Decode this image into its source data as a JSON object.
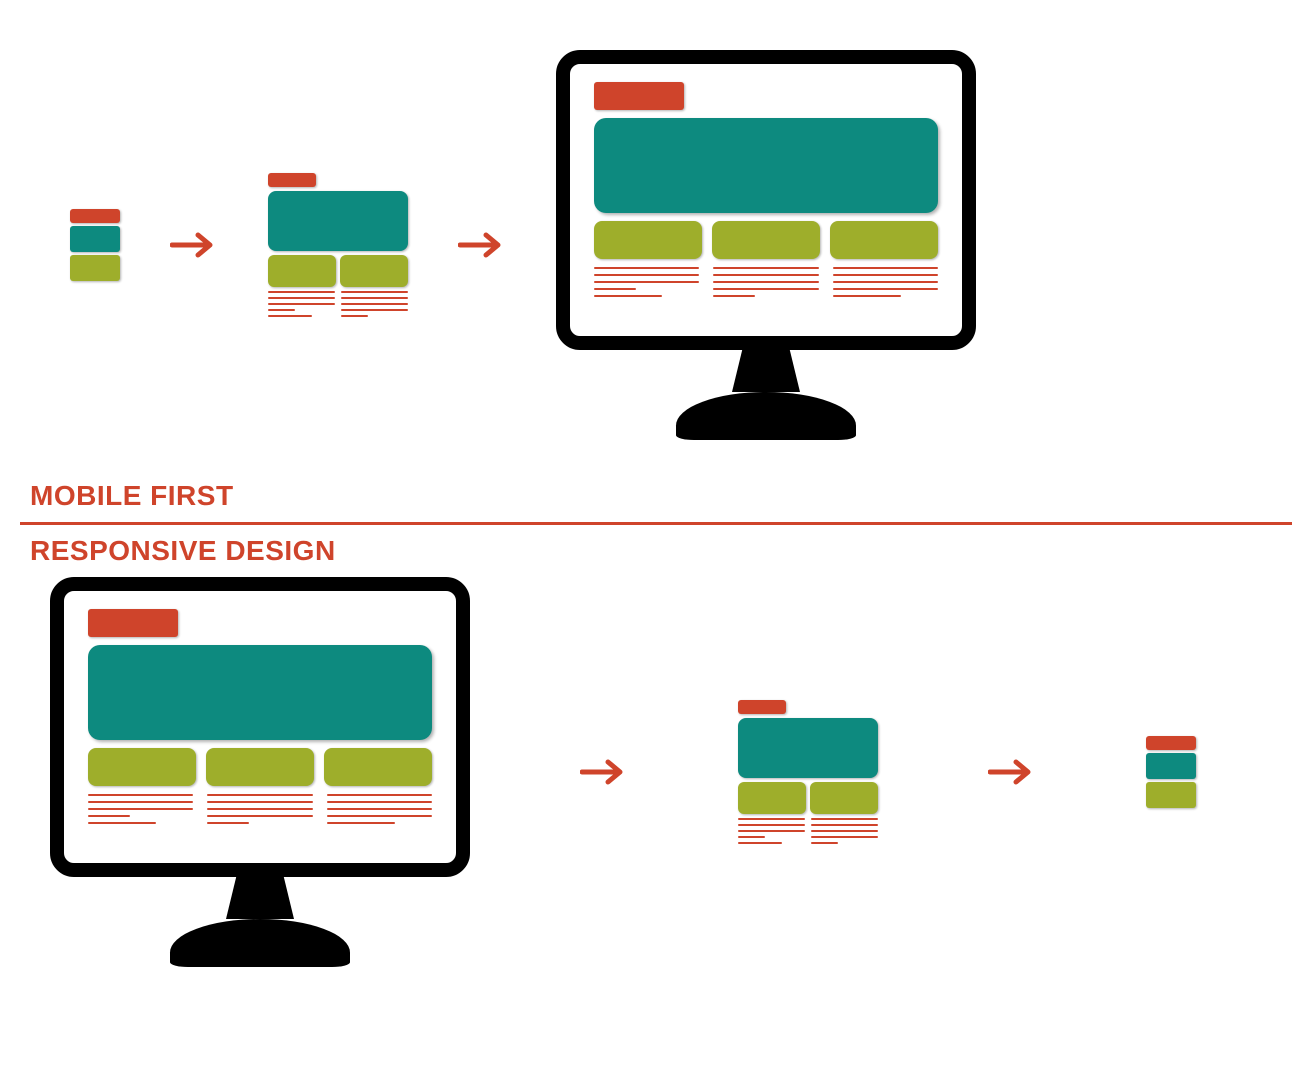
{
  "labels": {
    "mobile_first": "MOBILE FIRST",
    "responsive_design": "RESPONSIVE DESIGN"
  },
  "colors": {
    "accent": "#cf442b",
    "teal": "#0d8a7f",
    "olive": "#9eae2b",
    "frame": "#000000"
  },
  "diagram": {
    "top_flow": [
      "mobile",
      "arrow",
      "tablet",
      "arrow",
      "desktop"
    ],
    "bottom_flow": [
      "desktop",
      "arrow",
      "tablet",
      "arrow",
      "mobile"
    ]
  }
}
